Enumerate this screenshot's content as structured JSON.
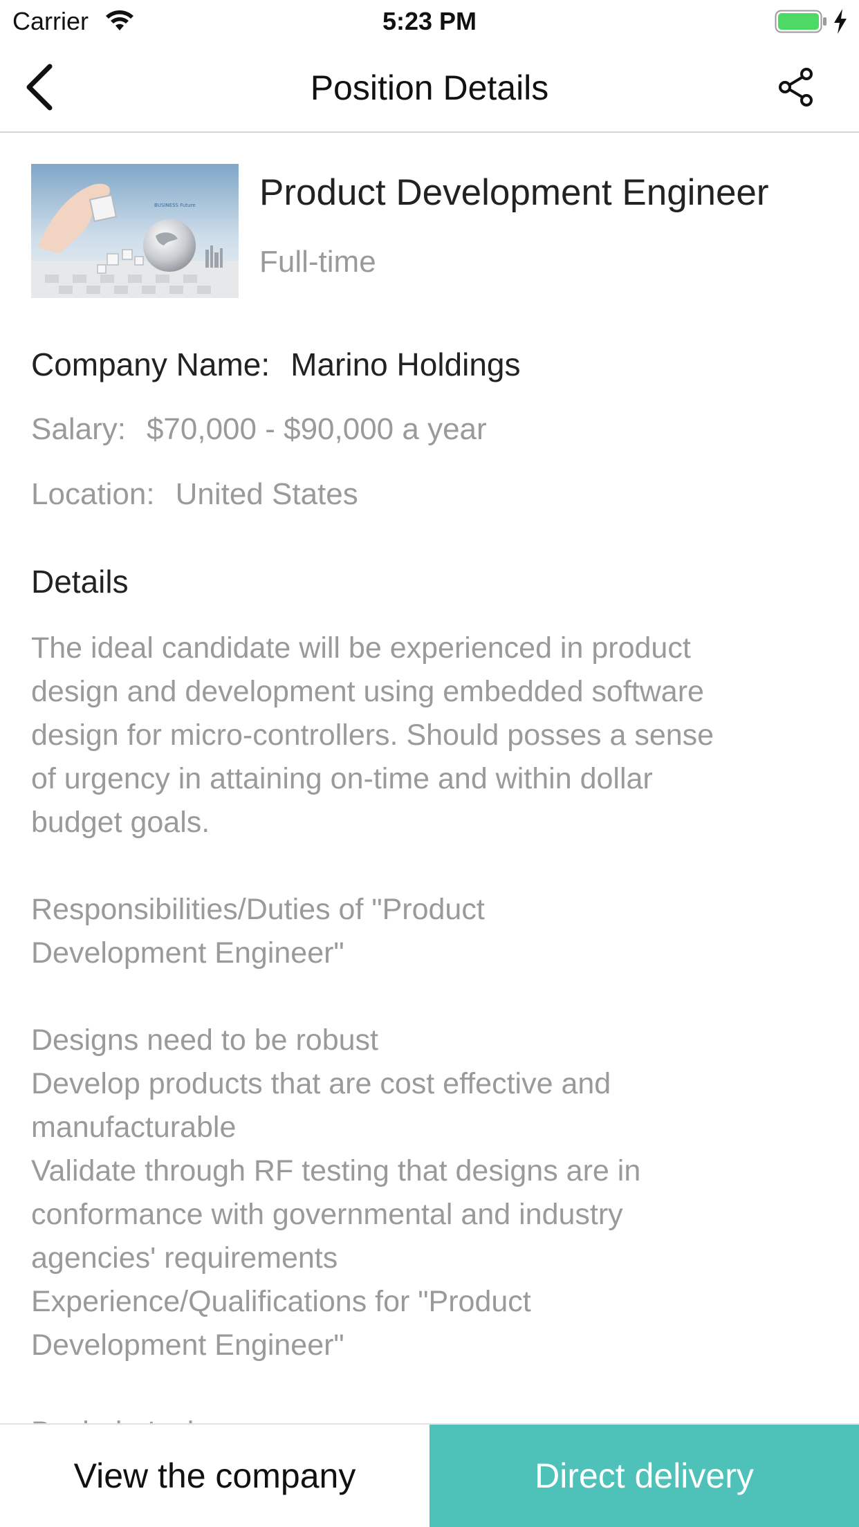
{
  "status_bar": {
    "carrier": "Carrier",
    "time": "5:23 PM",
    "battery_color": "#4cd964"
  },
  "nav": {
    "title": "Position Details",
    "back_icon": "chevron-left-icon",
    "share_icon": "share-icon"
  },
  "job": {
    "title": "Product Development Engineer",
    "type": "Full-time",
    "thumbnail_caption": "BUSINESS Future"
  },
  "info": {
    "company_label": "Company Name:",
    "company_value": "Marino Holdings",
    "salary_label": "Salary:",
    "salary_value": "$70,000 - $90,000 a year",
    "location_label": "Location:",
    "location_value": "United States"
  },
  "details": {
    "heading": "Details",
    "lines": [
      "The ideal candidate will be experienced in product",
      "design and development using embedded software",
      "design for micro-controllers. Should posses a sense",
      "of urgency in attaining on-time and within dollar",
      "budget goals.",
      "",
      "Responsibilities/Duties of \"Product",
      "Development Engineer\"",
      "",
      "Designs need to be robust",
      "Develop products that are cost effective and",
      "manufacturable",
      "Validate through RF testing that designs are in",
      "conformance with governmental and industry",
      "agencies' requirements",
      "Experience/Qualifications for \"Product",
      "Development Engineer\"",
      "",
      "Bachelor's degree"
    ]
  },
  "actions": {
    "view_company": "View the company",
    "direct_delivery": "Direct delivery",
    "accent_color": "#4ec2b9"
  }
}
